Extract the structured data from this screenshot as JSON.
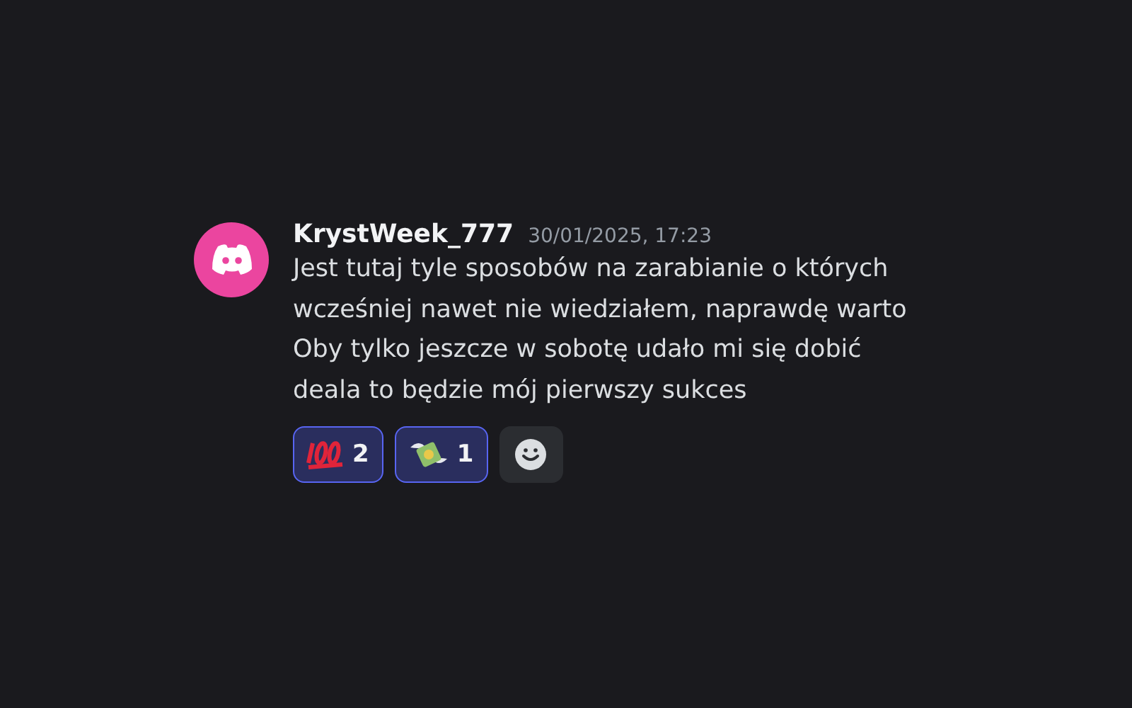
{
  "message": {
    "author": "KrystWeek_777",
    "timestamp": "30/01/2025, 17:23",
    "lines": [
      "Jest tutaj tyle sposobów na zarabianie o których",
      "wcześniej nawet nie wiedziałem, naprawdę warto",
      "Oby tylko jeszcze w sobotę udało mi się dobić",
      "deala to będzie mój pierwszy sukces"
    ],
    "reactions": [
      {
        "kind": "hundred",
        "count": "2",
        "selected": true
      },
      {
        "kind": "money",
        "count": "1",
        "selected": true
      }
    ]
  }
}
